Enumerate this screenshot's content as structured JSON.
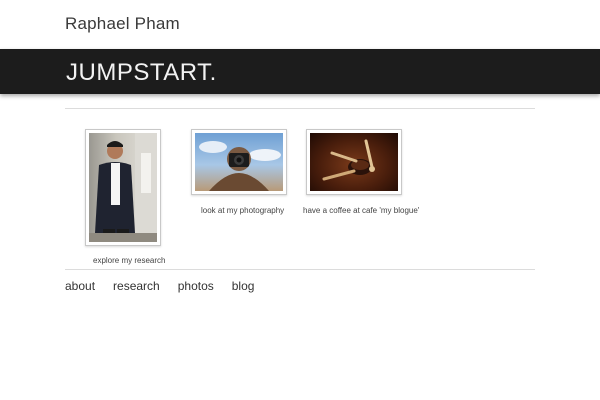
{
  "header": {
    "site_name": "Raphael Pham"
  },
  "banner": {
    "title": "JUMPSTART."
  },
  "gallery": [
    {
      "caption": "explore my research"
    },
    {
      "caption": "look at my photography"
    },
    {
      "caption": "have a coffee at cafe 'my blogue'"
    }
  ],
  "nav": {
    "items": [
      {
        "label": "about"
      },
      {
        "label": "research"
      },
      {
        "label": "photos"
      },
      {
        "label": "blog"
      }
    ]
  }
}
